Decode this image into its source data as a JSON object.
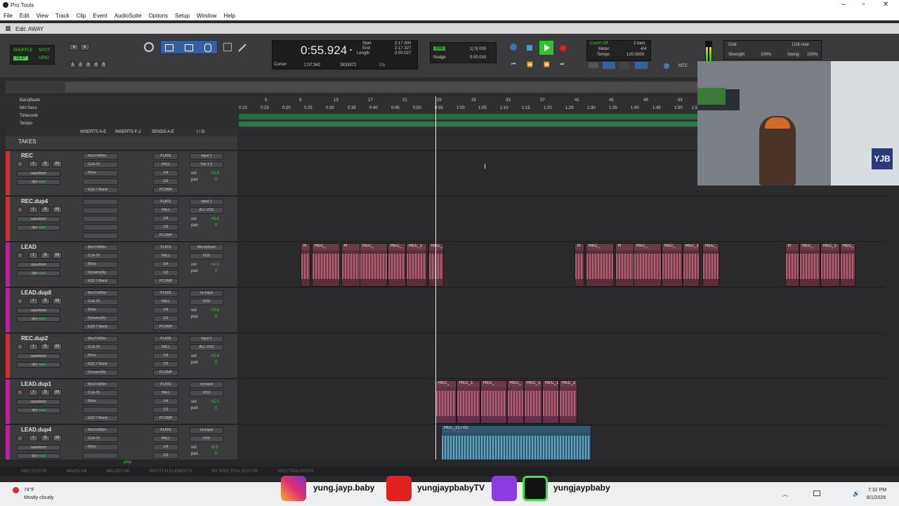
{
  "window": {
    "app_title": "Pro Tools",
    "edit_title": "Edit: AWAY"
  },
  "menu": [
    "File",
    "Edit",
    "View",
    "Track",
    "Clip",
    "Event",
    "AudioSuite",
    "Options",
    "Setup",
    "Window",
    "Help"
  ],
  "toolbar": {
    "modes": [
      "SHUFFLE",
      "SPOT",
      "SLIP",
      "GRID"
    ],
    "zoom_presets": [
      "1",
      "2",
      "3",
      "4",
      "5"
    ],
    "main_counter": "0:55.924",
    "start_label": "Start",
    "end_label": "End",
    "length_label": "Length",
    "start": "2:17.300",
    "end": "2:17.327",
    "length": "0:00.027",
    "cursor_label": "Cursor",
    "cursor": "1:07.942",
    "sample": "3833972",
    "dly_label": "Dly",
    "grid_label": "Grid",
    "grid_value": "1| 0| 000",
    "nudge_label": "Nudge",
    "nudge_value": "0.00.010",
    "count_off": "Count Off",
    "count_bars": "2 bars",
    "meter_label": "Meter",
    "meter": "4/4",
    "tempo_label": "Tempo",
    "tempo": "120.0000",
    "grid_right_label": "Grid:",
    "grid_right_value": "1/16 note",
    "strength_label": "Strength:",
    "strength": "100%",
    "swing_label": "Swing:",
    "swing": "100%",
    "mtc": "MTC"
  },
  "rulers": {
    "labels": [
      "Bars|Beats",
      "Min:Secs",
      "Timecode",
      "Tempo"
    ],
    "bars": [
      "5",
      "9",
      "13",
      "17",
      "21",
      "25",
      "29",
      "33",
      "37",
      "41",
      "45",
      "49",
      "53",
      "57"
    ],
    "secs": [
      "0:10",
      "0:15",
      "0:20",
      "0:25",
      "0:30",
      "0:35",
      "0:40",
      "0:45",
      "0:50",
      "0:55",
      "1:00",
      "1:05",
      "1:10",
      "1:15",
      "1:20",
      "1:25",
      "1:30",
      "1:35",
      "1:40",
      "1:45",
      "1:50",
      "1:5"
    ]
  },
  "columns": {
    "inserts_ae": "INSERTS A-E",
    "inserts_fj": "INSERTS F-J",
    "sends": "SENDS A-E",
    "io": "I / O",
    "takes": "TAKES"
  },
  "tracks": [
    {
      "name": "REC",
      "color": "#d23030",
      "inserts": [
        "WvsTnRtIm",
        "CLA-76",
        "RVox",
        "",
        "EQ3 7-Band"
      ],
      "sends": [
        "PLATE",
        "HALL",
        "1/4",
        "1/2",
        "PCOMP"
      ],
      "io": [
        "Input 1",
        "Out 1-2"
      ],
      "vol": "+5.4",
      "pan": "0"
    },
    {
      "name": "REC.dup4",
      "color": "#d23030",
      "inserts": [
        "",
        "",
        "",
        "",
        ""
      ],
      "sends": [
        "PLATE",
        "HALL",
        "1/4",
        "1/2",
        "PCOMP"
      ],
      "io": [
        "Input 1",
        "ALL VOX"
      ],
      "vol": "+5.4",
      "pan": "0"
    },
    {
      "name": "LEAD",
      "color": "#c020a0",
      "inserts": [
        "WvsTnRtIm",
        "CLA-76",
        "RVox",
        "DynamoDly",
        "EQ3 7-Band"
      ],
      "sends": [
        "PLATE",
        "HALL",
        "1/4",
        "1/2",
        "PCOMP"
      ],
      "io": [
        "Microphone",
        "VOX"
      ],
      "vol": "+4.0",
      "pan": "0"
    },
    {
      "name": "LEAD.dup8",
      "color": "#c020a0",
      "inserts": [
        "WvsTnRtIm",
        "CLA-76",
        "RVox",
        "DynamoDly",
        "EQ3 7-Band"
      ],
      "sends": [
        "PLATE",
        "HALL",
        "1/4",
        "1/2",
        "PCOMP"
      ],
      "io": [
        "no input",
        "VOX"
      ],
      "vol": "+3.6",
      "pan": "0"
    },
    {
      "name": "REC.dup2",
      "color": "#d23030",
      "inserts": [
        "WvsTnRtIm",
        "CLA-76",
        "RVox",
        "EQ3 7-Band",
        "DynamoDly"
      ],
      "sends": [
        "PLATE",
        "HALL",
        "1/4",
        "1/2",
        "PCOMP"
      ],
      "io": [
        "Input 1",
        "ALL VOX"
      ],
      "vol": "+5.4",
      "pan": "0"
    },
    {
      "name": "LEAD.dup1",
      "color": "#c020a0",
      "inserts": [
        "WvsTnRtIm",
        "CLA-76",
        "RVox",
        "",
        "EQ3 7-Band"
      ],
      "sends": [
        "PLATE",
        "HALL",
        "1/4",
        "1/2",
        "PCOMP"
      ],
      "io": [
        "no input",
        "VOX"
      ],
      "vol": "+2.1",
      "pan": "0"
    },
    {
      "name": "LEAD.dup4",
      "color": "#c020a0",
      "inserts": [
        "WvsTnRtIm",
        "CLA-76",
        "RVox",
        "",
        ""
      ],
      "sends": [
        "PLATE",
        "HALL",
        "1/4",
        "1/2",
        ""
      ],
      "io": [
        "no input",
        "VOX"
      ],
      "vol": "-8.9",
      "pan": "0"
    }
  ],
  "track_buttons": {
    "input": "I",
    "solo": "S",
    "mute": "M",
    "view": "waveform",
    "dyn": "dyn",
    "read": "read",
    "vol_label": "vol",
    "pan_label": "pan"
  },
  "clips": {
    "rec": "REC_",
    "rec1": "REC_1",
    "rec2": "REC_2",
    "rec_r": "R",
    "rec_217": "REC_217-01",
    "gain": "0 dB"
  },
  "bottom_tabs": [
    "MIDI EDITOR",
    "WAVELAB",
    "MELODYNE",
    "REPITCH ELEMENTS",
    "RX SPECTRAL EDITOR",
    "SPECTRALAYERS"
  ],
  "status": {
    "play": "play"
  },
  "social": {
    "instagram": "yung.jayp.baby",
    "youtube": "yungjaypbabyTV",
    "kick": "yungjaypbaby"
  },
  "taskbar": {
    "temp": "74°F",
    "weather": "Mostly cloudy",
    "time": "7:32 PM",
    "date": "8/1/2026"
  },
  "webcam": {
    "badge": "YJB"
  }
}
